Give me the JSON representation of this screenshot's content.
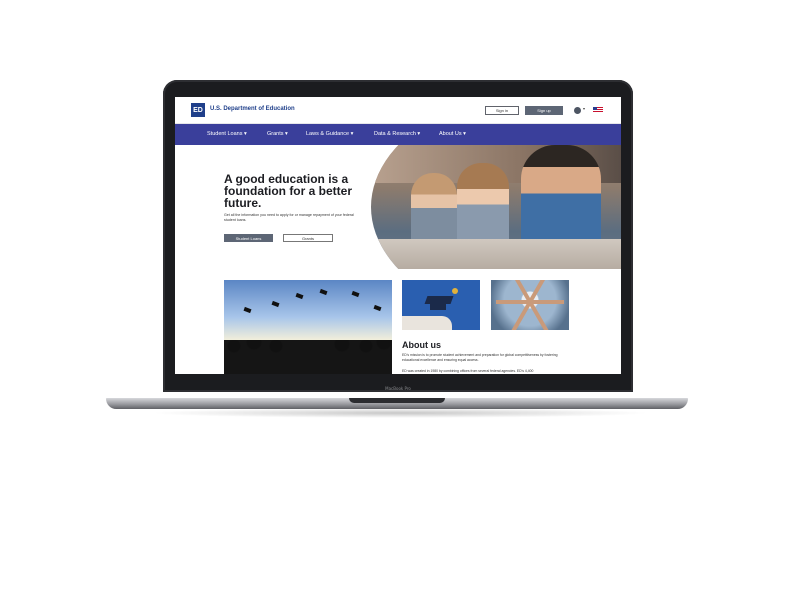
{
  "header": {
    "logo_mark": "ED",
    "brand": "U.S. Department of Education",
    "sign_in": "Sign in",
    "sign_up": "Sign up",
    "lang_chevron": "▾"
  },
  "nav": {
    "items": [
      "Student Loans ▾",
      "Grants ▾",
      "Laws & Guidance ▾",
      "Data & Research ▾",
      "About Us ▾"
    ]
  },
  "hero": {
    "title": "A good education is a foundation for a better future.",
    "text": "Get all the information you need to apply for or manage repayment of your federal student loans.",
    "button_primary": "Student Loans",
    "button_secondary": "Grants"
  },
  "about": {
    "heading": "About us",
    "p1": "ED's mission is to promote student achievement and preparation for global competitiveness by fostering educational excellence and ensuring equal access.",
    "p2": "ED was created in 1980 by combining offices from several federal agencies. ED's 4,400"
  },
  "device": {
    "label": "MacBook Pro"
  },
  "colors": {
    "nav_bg": "#3a3f9b",
    "brand": "#1f3f8a",
    "button_dark": "#5d6675"
  }
}
